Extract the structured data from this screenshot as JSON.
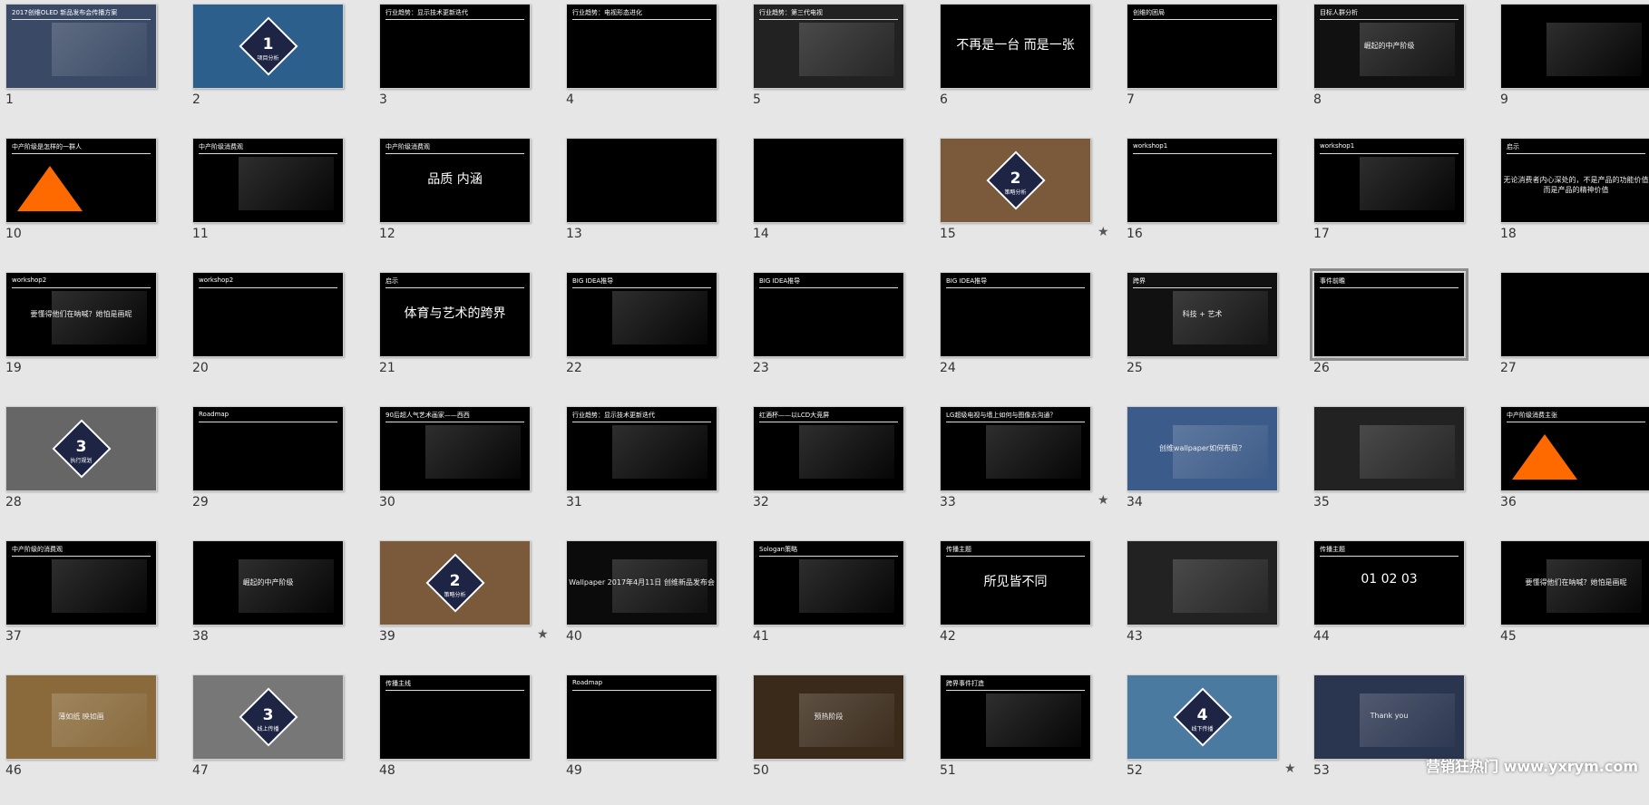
{
  "app": {
    "watermark": "营销狂热门 www.yxrym.com"
  },
  "slides": [
    {
      "n": "1",
      "kind": "photo",
      "bg": "#3a4a66",
      "title": "2017创维OLED 新品发布会传播方案",
      "star": false
    },
    {
      "n": "2",
      "kind": "diamond",
      "bg": "#2d5f8c",
      "dnum": "1",
      "dtext": "项目分析",
      "star": false
    },
    {
      "n": "3",
      "kind": "text",
      "bg": "#000",
      "title": "行业趋势：显示技术更新迭代",
      "body": "",
      "star": false
    },
    {
      "n": "4",
      "kind": "text",
      "bg": "#000",
      "title": "行业趋势：电视形态进化",
      "body": "",
      "star": false
    },
    {
      "n": "5",
      "kind": "photo",
      "bg": "#222",
      "title": "行业趋势：第三代电视",
      "star": false
    },
    {
      "n": "6",
      "kind": "text",
      "bg": "#000",
      "title": "",
      "body": "不再是一台   而是一张",
      "star": false
    },
    {
      "n": "7",
      "kind": "text",
      "bg": "#000",
      "title": "创维的困局",
      "body": "",
      "star": false
    },
    {
      "n": "8",
      "kind": "photo",
      "bg": "#111",
      "title": "目标人群分析",
      "body": "崛起的中产阶级",
      "star": false
    },
    {
      "n": "9",
      "kind": "photo",
      "bg": "#000",
      "title": "",
      "star": true
    },
    {
      "n": "10",
      "kind": "pyramid",
      "bg": "#000",
      "title": "中产阶级是怎样的一群人",
      "star": false
    },
    {
      "n": "11",
      "kind": "photo",
      "bg": "#000",
      "title": "中产阶级消费观",
      "star": false
    },
    {
      "n": "12",
      "kind": "text",
      "bg": "#000",
      "title": "中产阶级消费观",
      "body": "品质        内涵",
      "star": false
    },
    {
      "n": "13",
      "kind": "text",
      "bg": "#000",
      "title": "",
      "body": "",
      "star": false
    },
    {
      "n": "14",
      "kind": "text",
      "bg": "#000",
      "title": "",
      "body": "",
      "star": false
    },
    {
      "n": "15",
      "kind": "diamond",
      "bg": "#7a5a3a",
      "dnum": "2",
      "dtext": "策略分析",
      "star": true
    },
    {
      "n": "16",
      "kind": "text",
      "bg": "#000",
      "title": "workshop1",
      "body": "",
      "star": false
    },
    {
      "n": "17",
      "kind": "photo",
      "bg": "#000",
      "title": "workshop1",
      "star": false
    },
    {
      "n": "18",
      "kind": "text",
      "bg": "#000",
      "title": "启示",
      "body": "无论消费者内心深处的，不是产品的功能价值而是产品的精神价值",
      "star": false
    },
    {
      "n": "19",
      "kind": "photo",
      "bg": "#000",
      "title": "workshop2",
      "body": "要懂得他们在呐喊？她怕是画呢",
      "star": false
    },
    {
      "n": "20",
      "kind": "text",
      "bg": "#000",
      "title": "workshop2",
      "body": "",
      "star": false
    },
    {
      "n": "21",
      "kind": "text",
      "bg": "#000",
      "title": "启示",
      "body": "体育与艺术的跨界",
      "star": false
    },
    {
      "n": "22",
      "kind": "photo",
      "bg": "#000",
      "title": "BIG IDEA推导",
      "star": false
    },
    {
      "n": "23",
      "kind": "text",
      "bg": "#000",
      "title": "BIG IDEA推导",
      "body": "",
      "star": false
    },
    {
      "n": "24",
      "kind": "text",
      "bg": "#000",
      "title": "BIG IDEA推导",
      "body": "",
      "star": false
    },
    {
      "n": "25",
      "kind": "photo",
      "bg": "#111",
      "title": "跨界",
      "body": "科技 + 艺术",
      "star": false
    },
    {
      "n": "26",
      "kind": "text",
      "bg": "#000",
      "title": "事件前瞻",
      "body": "",
      "star": false,
      "selected": true
    },
    {
      "n": "27",
      "kind": "text",
      "bg": "#000",
      "title": "",
      "body": "",
      "star": false
    },
    {
      "n": "28",
      "kind": "diamond",
      "bg": "#666",
      "dnum": "3",
      "dtext": "执行规划",
      "star": false
    },
    {
      "n": "29",
      "kind": "text",
      "bg": "#000",
      "title": "Roadmap",
      "body": "",
      "star": false
    },
    {
      "n": "30",
      "kind": "photo",
      "bg": "#000",
      "title": "90后超人气艺术画家——西西",
      "star": false
    },
    {
      "n": "31",
      "kind": "photo",
      "bg": "#000",
      "title": "行业趋势：显示技术更新迭代",
      "star": false
    },
    {
      "n": "32",
      "kind": "photo",
      "bg": "#000",
      "title": "红酒杯——以LCD大竞屏",
      "star": false
    },
    {
      "n": "33",
      "kind": "photo",
      "bg": "#000",
      "title": "LG超级电视与墙上如何与图像去沟通？",
      "star": true
    },
    {
      "n": "34",
      "kind": "photo",
      "bg": "#3b5b8a",
      "title": "",
      "body": "创维wallpaper如何布局？",
      "star": false
    },
    {
      "n": "35",
      "kind": "photo",
      "bg": "#222",
      "title": "",
      "star": false
    },
    {
      "n": "36",
      "kind": "pyramid",
      "bg": "#000",
      "title": "中产阶级消费主张",
      "star": false
    },
    {
      "n": "37",
      "kind": "photo",
      "bg": "#000",
      "title": "中产阶级的消费观",
      "star": false
    },
    {
      "n": "38",
      "kind": "photo",
      "bg": "#000",
      "title": "",
      "body": "崛起的中产阶级",
      "star": false
    },
    {
      "n": "39",
      "kind": "diamond",
      "bg": "#7a5a3a",
      "dnum": "2",
      "dtext": "策略分析",
      "star": true
    },
    {
      "n": "40",
      "kind": "photo",
      "bg": "#0b0b0b",
      "title": "",
      "body": "Wallpaper 2017年4月11日 创维新品发布会",
      "star": false
    },
    {
      "n": "41",
      "kind": "photo",
      "bg": "#000",
      "title": "Sologan策略",
      "star": false
    },
    {
      "n": "42",
      "kind": "text",
      "bg": "#000",
      "title": "传播主题",
      "body": "所见皆不同",
      "star": false
    },
    {
      "n": "43",
      "kind": "photo",
      "bg": "#222",
      "title": "",
      "star": false
    },
    {
      "n": "44",
      "kind": "text",
      "bg": "#000",
      "title": "传播主题",
      "body": "01  02  03",
      "star": false
    },
    {
      "n": "45",
      "kind": "photo",
      "bg": "#000",
      "title": "",
      "body": "要懂得他们在呐喊？她怕是画呢",
      "star": false
    },
    {
      "n": "46",
      "kind": "photo",
      "bg": "#8a6a3a",
      "title": "",
      "body": "薄如纸 映如画",
      "star": false
    },
    {
      "n": "47",
      "kind": "diamond",
      "bg": "#777",
      "dnum": "3",
      "dtext": "线上传播",
      "star": false
    },
    {
      "n": "48",
      "kind": "text",
      "bg": "#000",
      "title": "传播主线",
      "body": "",
      "star": false
    },
    {
      "n": "49",
      "kind": "text",
      "bg": "#000",
      "title": "Roadmap",
      "body": "",
      "star": false
    },
    {
      "n": "50",
      "kind": "photo",
      "bg": "#3a2a1a",
      "title": "",
      "body": "预热阶段",
      "star": false
    },
    {
      "n": "51",
      "kind": "photo",
      "bg": "#000",
      "title": "跨界事件打造",
      "star": false
    },
    {
      "n": "52",
      "kind": "diamond",
      "bg": "#4a7aa0",
      "dnum": "4",
      "dtext": "线下传播",
      "star": true
    },
    {
      "n": "53",
      "kind": "photo",
      "bg": "#2a3550",
      "title": "",
      "body": "Thank you",
      "star": false
    }
  ],
  "colors": {
    "diamond_fill": "#1d2444",
    "accent_orange": "#ff6a00"
  },
  "icons": {
    "star": "star-icon"
  }
}
